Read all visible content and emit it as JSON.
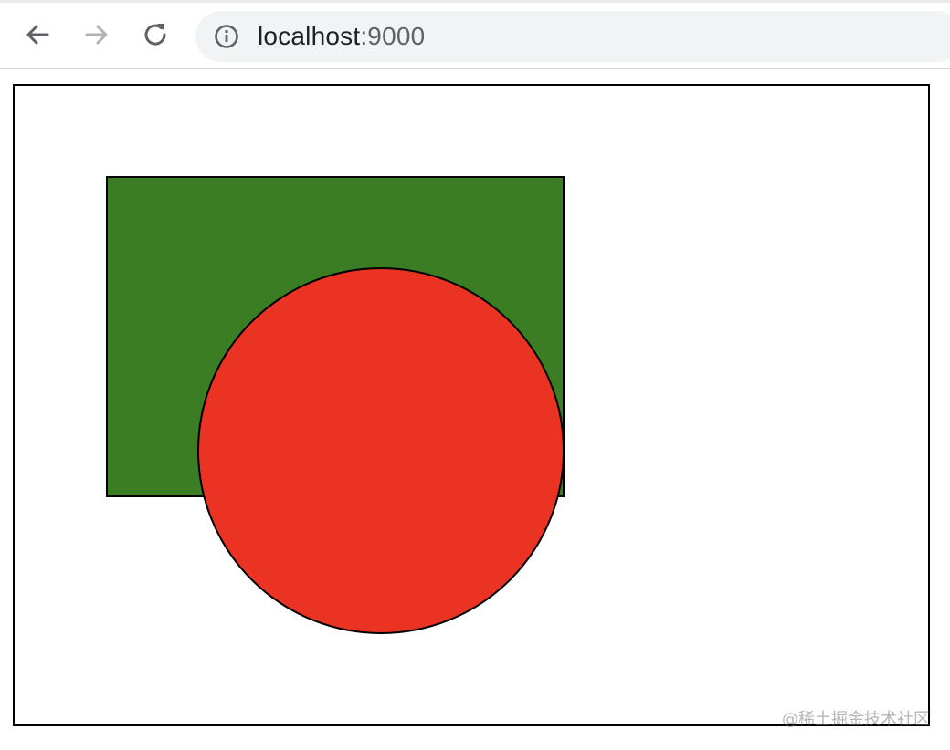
{
  "browser": {
    "url_host": "localhost",
    "url_port": ":9000",
    "icons": {
      "back": "arrow-left-icon",
      "forward": "arrow-right-icon",
      "reload": "reload-icon",
      "site_info": "info-circle-icon"
    }
  },
  "canvas": {
    "shapes": [
      {
        "type": "rect",
        "fill": "#3a7d23",
        "stroke": "#000000"
      },
      {
        "type": "circle",
        "fill": "#eb3323",
        "stroke": "#000000"
      }
    ]
  },
  "watermark": {
    "text": "@稀土掘金技术社区"
  }
}
